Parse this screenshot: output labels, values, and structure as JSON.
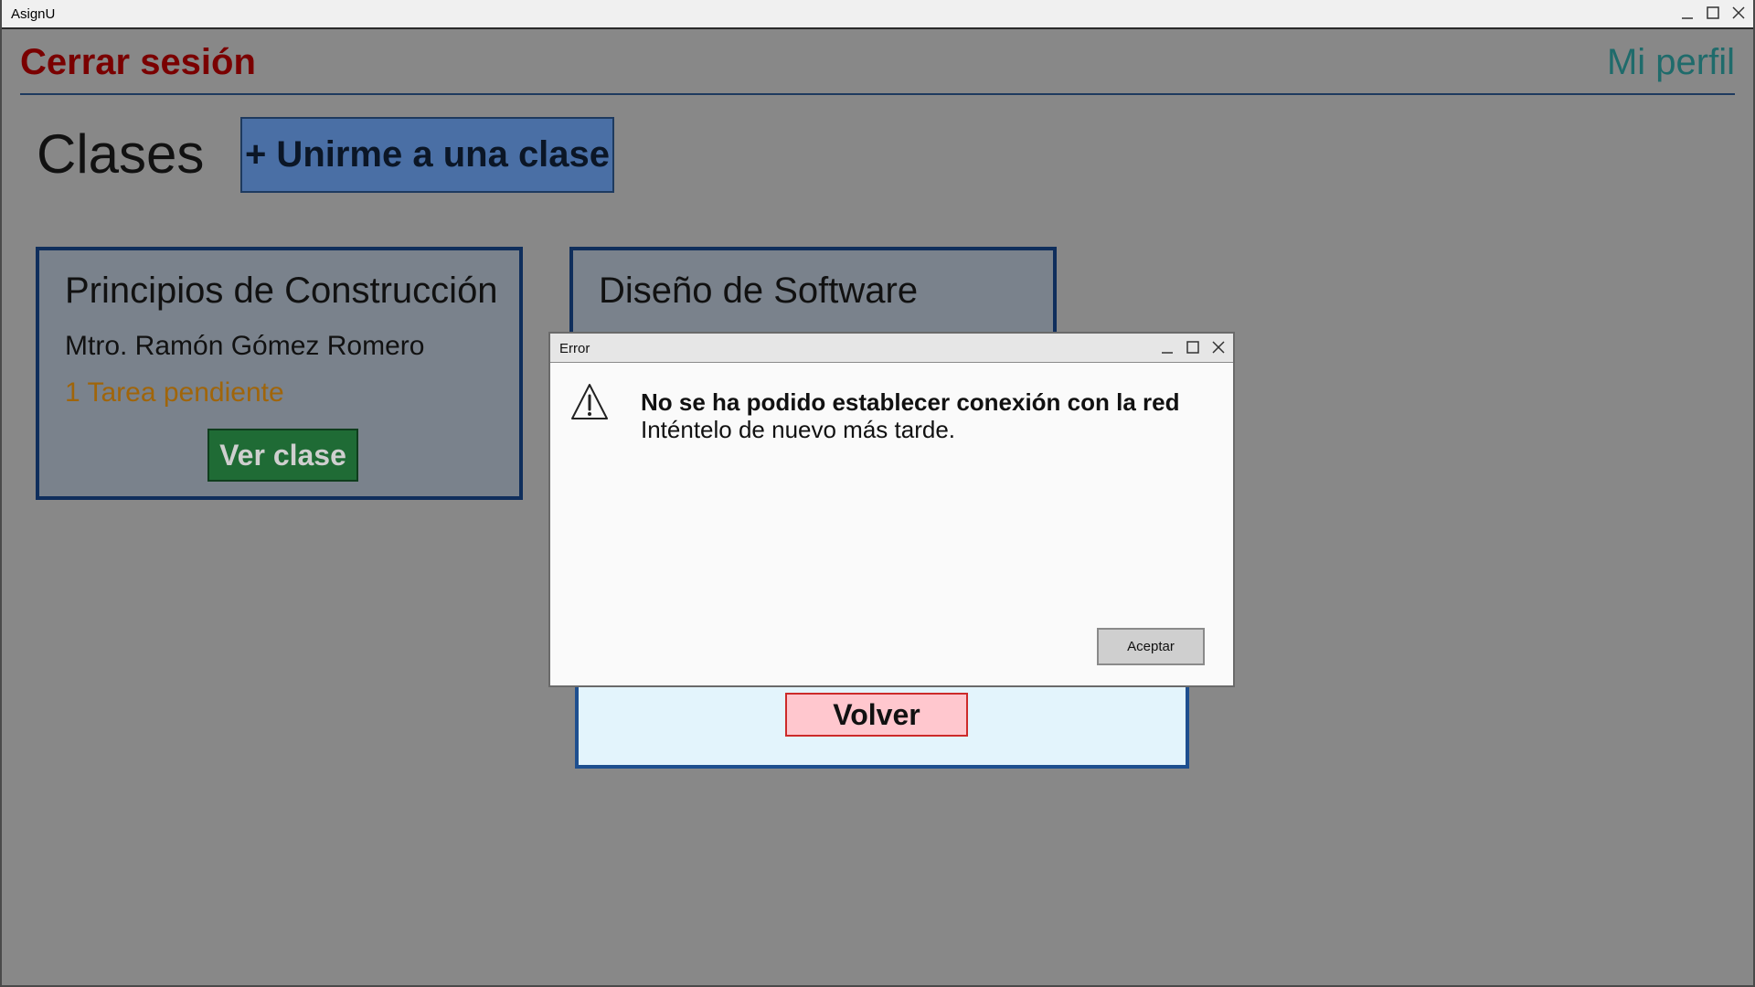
{
  "window": {
    "title": "AsignU"
  },
  "header": {
    "logout_label": "Cerrar sesión",
    "profile_label": "Mi perfil"
  },
  "classes": {
    "section_title": "Clases",
    "join_button_label": "+ Unirme a una clase",
    "cards": [
      {
        "name": "Principios de Construcción",
        "teacher": "Mtro. Ramón Gómez Romero",
        "pending": "1 Tarea pendiente",
        "view_label": "Ver clase"
      },
      {
        "name": "Diseño de Software"
      }
    ]
  },
  "background_panel": {
    "back_button_label": "Volver"
  },
  "dialog": {
    "title": "Error",
    "heading": "No se ha podido establecer conexión con la red",
    "message": "Inténtelo de nuevo más tarde.",
    "accept_label": "Aceptar",
    "icon": "warning-icon"
  },
  "colors": {
    "overlay_bg": "#888888",
    "logout": "#7a0000",
    "profile": "#1f6b6b",
    "join_button": "#4a6fa5",
    "card_bg": "#7a828c",
    "card_border": "#0f2e5c",
    "pending": "#a0650a",
    "view_button": "#1f6b35",
    "back_button": "#ffc7ce",
    "dialog_bg": "#fafafa"
  }
}
